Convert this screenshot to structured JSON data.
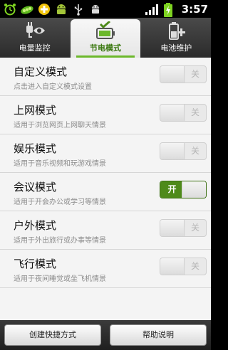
{
  "status_bar": {
    "time": "3:57",
    "left_icons": [
      "alarm-clock-icon",
      "peapod-app-icon",
      "extra-add-icon",
      "android-robot-icon",
      "usb-icon",
      "android-debug-icon"
    ],
    "right_icons": [
      "signal-bars-icon",
      "battery-charging-icon"
    ]
  },
  "tabs": [
    {
      "label": "电量监控",
      "icon": "plug-eye-icon",
      "active": false
    },
    {
      "label": "节电模式",
      "icon": "battery-check-icon",
      "active": true
    },
    {
      "label": "电池维护",
      "icon": "battery-plus-icon",
      "active": false
    }
  ],
  "modes": [
    {
      "title": "自定义模式",
      "subtitle": "点击进入自定义模式设置",
      "toggle_label": "关",
      "on": false
    },
    {
      "title": "上网模式",
      "subtitle": "适用于浏览网页上网聊天情景",
      "toggle_label": "关",
      "on": false
    },
    {
      "title": "娱乐模式",
      "subtitle": "适用于音乐视频和玩游戏情景",
      "toggle_label": "关",
      "on": false
    },
    {
      "title": "会议模式",
      "subtitle": "适用于开会办公或学习等情景",
      "toggle_label": "开",
      "on": true
    },
    {
      "title": "户外模式",
      "subtitle": "适用于外出旅行或办事等情景",
      "toggle_label": "关",
      "on": false
    },
    {
      "title": "飞行模式",
      "subtitle": "适用于夜间睡觉或坐飞机情景",
      "toggle_label": "关",
      "on": false
    }
  ],
  "bottom": {
    "create_shortcut_label": "创建快捷方式",
    "help_label": "帮助说明"
  },
  "colors": {
    "accent_green": "#4e8a1a",
    "tab_active_text": "#3d7a12"
  }
}
